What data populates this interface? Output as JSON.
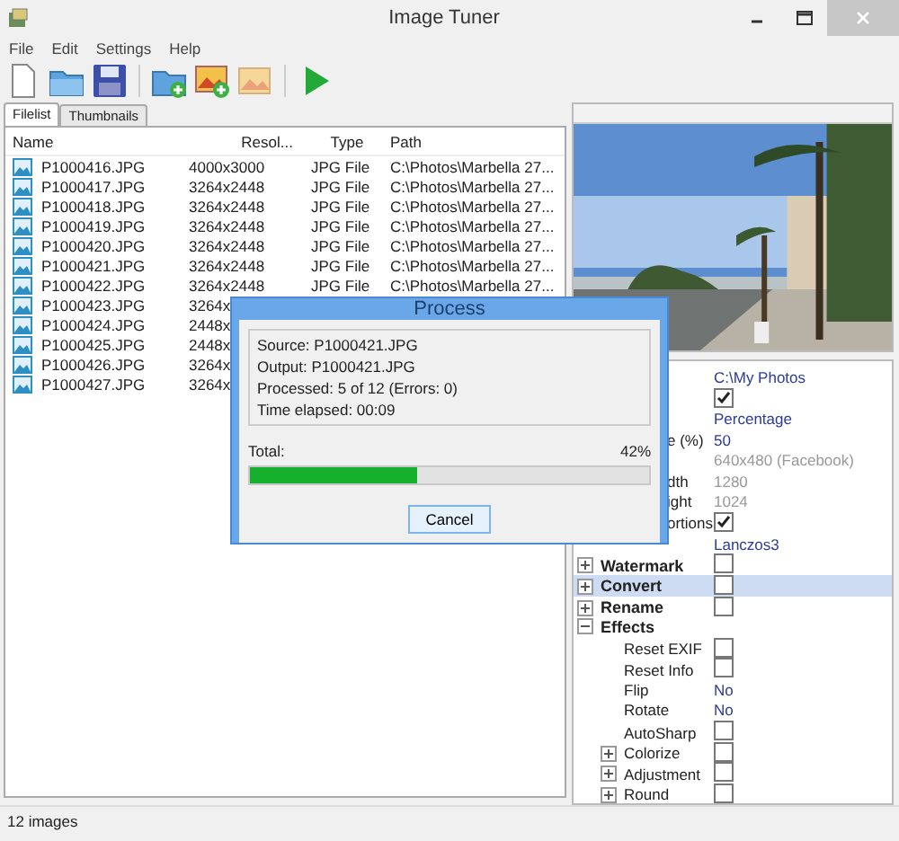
{
  "window": {
    "title": "Image Tuner"
  },
  "menu": [
    "File",
    "Edit",
    "Settings",
    "Help"
  ],
  "tabs": [
    {
      "label": "Filelist",
      "selected": true
    },
    {
      "label": "Thumbnails",
      "selected": false
    }
  ],
  "filelist": {
    "columns": [
      "Name",
      "Resol...",
      "Type",
      "Path"
    ],
    "rows": [
      {
        "name": "P1000416.JPG",
        "resolution": "4000x3000",
        "type": "JPG File",
        "path": "C:\\Photos\\Marbella 27..."
      },
      {
        "name": "P1000417.JPG",
        "resolution": "3264x2448",
        "type": "JPG File",
        "path": "C:\\Photos\\Marbella 27..."
      },
      {
        "name": "P1000418.JPG",
        "resolution": "3264x2448",
        "type": "JPG File",
        "path": "C:\\Photos\\Marbella 27..."
      },
      {
        "name": "P1000419.JPG",
        "resolution": "3264x2448",
        "type": "JPG File",
        "path": "C:\\Photos\\Marbella 27..."
      },
      {
        "name": "P1000420.JPG",
        "resolution": "3264x2448",
        "type": "JPG File",
        "path": "C:\\Photos\\Marbella 27..."
      },
      {
        "name": "P1000421.JPG",
        "resolution": "3264x2448",
        "type": "JPG File",
        "path": "C:\\Photos\\Marbella 27..."
      },
      {
        "name": "P1000422.JPG",
        "resolution": "3264x2448",
        "type": "JPG File",
        "path": "C:\\Photos\\Marbella 27..."
      },
      {
        "name": "P1000423.JPG",
        "resolution": "3264x"
      },
      {
        "name": "P1000424.JPG",
        "resolution": "2448x"
      },
      {
        "name": "P1000425.JPG",
        "resolution": "2448x"
      },
      {
        "name": "P1000426.JPG",
        "resolution": "3264x"
      },
      {
        "name": "P1000427.JPG",
        "resolution": "3264x"
      }
    ]
  },
  "properties": {
    "partly_hidden_rows": [
      {
        "kind": "text",
        "value": "C:\\My Photos",
        "disabled": false
      },
      {
        "kind": "check",
        "checked": true
      },
      {
        "kind": "text",
        "value": "Percentage",
        "disabled": false
      },
      {
        "kind": "text",
        "label": "e (%)",
        "value": "50",
        "disabled": false
      },
      {
        "kind": "text",
        "value": "640x480 (Facebook)",
        "disabled": true
      },
      {
        "kind": "text",
        "label": "dth",
        "value": "1280",
        "disabled": true
      },
      {
        "kind": "text",
        "label": "ight",
        "value": "1024",
        "disabled": true
      },
      {
        "kind": "check",
        "label": "ortions",
        "checked": true
      },
      {
        "kind": "text",
        "value": "Lanczos3",
        "disabled": false
      }
    ],
    "sections": [
      {
        "label": "Watermark",
        "kind": "check",
        "checked": false,
        "expanded": false,
        "selected": false
      },
      {
        "label": "Convert",
        "kind": "check",
        "checked": false,
        "expanded": false,
        "selected": true
      },
      {
        "label": "Rename",
        "kind": "check",
        "checked": false,
        "expanded": false,
        "selected": false
      },
      {
        "label": "Effects",
        "kind": "group",
        "expanded": true,
        "selected": false,
        "children": [
          {
            "label": "Reset EXIF",
            "kind": "check",
            "checked": false
          },
          {
            "label": "Reset Info",
            "kind": "check",
            "checked": false
          },
          {
            "label": "Flip",
            "kind": "text",
            "value": "No"
          },
          {
            "label": "Rotate",
            "kind": "text",
            "value": "No"
          },
          {
            "label": "AutoSharp",
            "kind": "check",
            "checked": false
          },
          {
            "label": "Colorize",
            "kind": "check",
            "checked": false,
            "expanded": false
          },
          {
            "label": "Adjustment",
            "kind": "check",
            "checked": false,
            "expanded": false
          },
          {
            "label": "Round",
            "kind": "check",
            "checked": false,
            "expanded": false
          }
        ]
      }
    ]
  },
  "status_bar": "12 images",
  "dialog": {
    "title": "Process",
    "info": [
      "Source: P1000421.JPG",
      "Output: P1000421.JPG",
      "Processed: 5 of 12 (Errors: 0)",
      "Time elapsed: 00:09"
    ],
    "total_label": "Total:",
    "percent": "42%",
    "level": 0.42,
    "button": "Cancel"
  }
}
